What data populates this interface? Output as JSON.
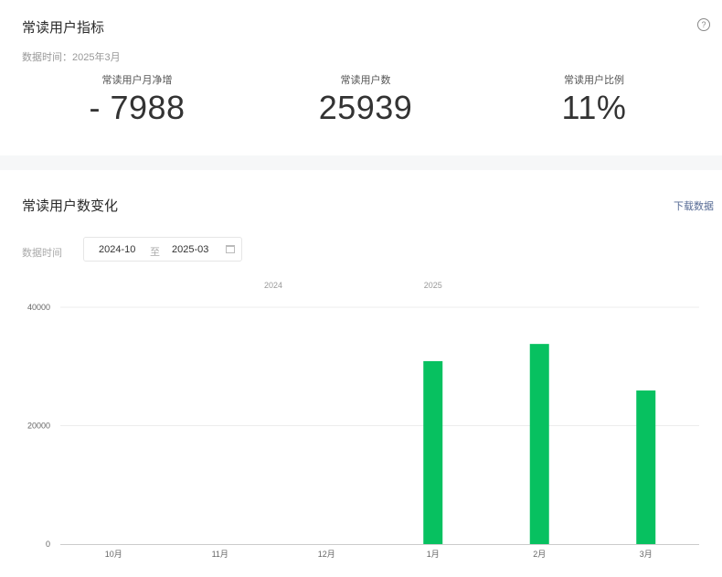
{
  "section1": {
    "title": "常读用户指标",
    "data_time": "数据时间：2025年3月",
    "metrics": [
      {
        "label": "常读用户月净增",
        "value": "- 7988"
      },
      {
        "label": "常读用户数",
        "value": "25939"
      },
      {
        "label": "常读用户比例",
        "value": "11%"
      }
    ]
  },
  "section2": {
    "title": "常读用户数变化",
    "download_label": "下载数据",
    "range_label": "数据时间",
    "range_start": "2024-10",
    "range_sep": "至",
    "range_end": "2025-03"
  },
  "help_icon_glyph": "?",
  "chart_data": {
    "type": "bar",
    "categories": [
      "10月",
      "11月",
      "12月",
      "1月",
      "2月",
      "3月"
    ],
    "year_labels": [
      {
        "label": "2024",
        "category_index": 1.5
      },
      {
        "label": "2025",
        "category_index": 3
      }
    ],
    "values": [
      0,
      0,
      0,
      30900,
      33800,
      25939
    ],
    "ylim": [
      0,
      40000
    ],
    "yticks": [
      0,
      20000,
      40000
    ],
    "grid": true,
    "bar_color": "#07c160",
    "axis_color": "#cccccc",
    "grid_color": "#ececec"
  }
}
